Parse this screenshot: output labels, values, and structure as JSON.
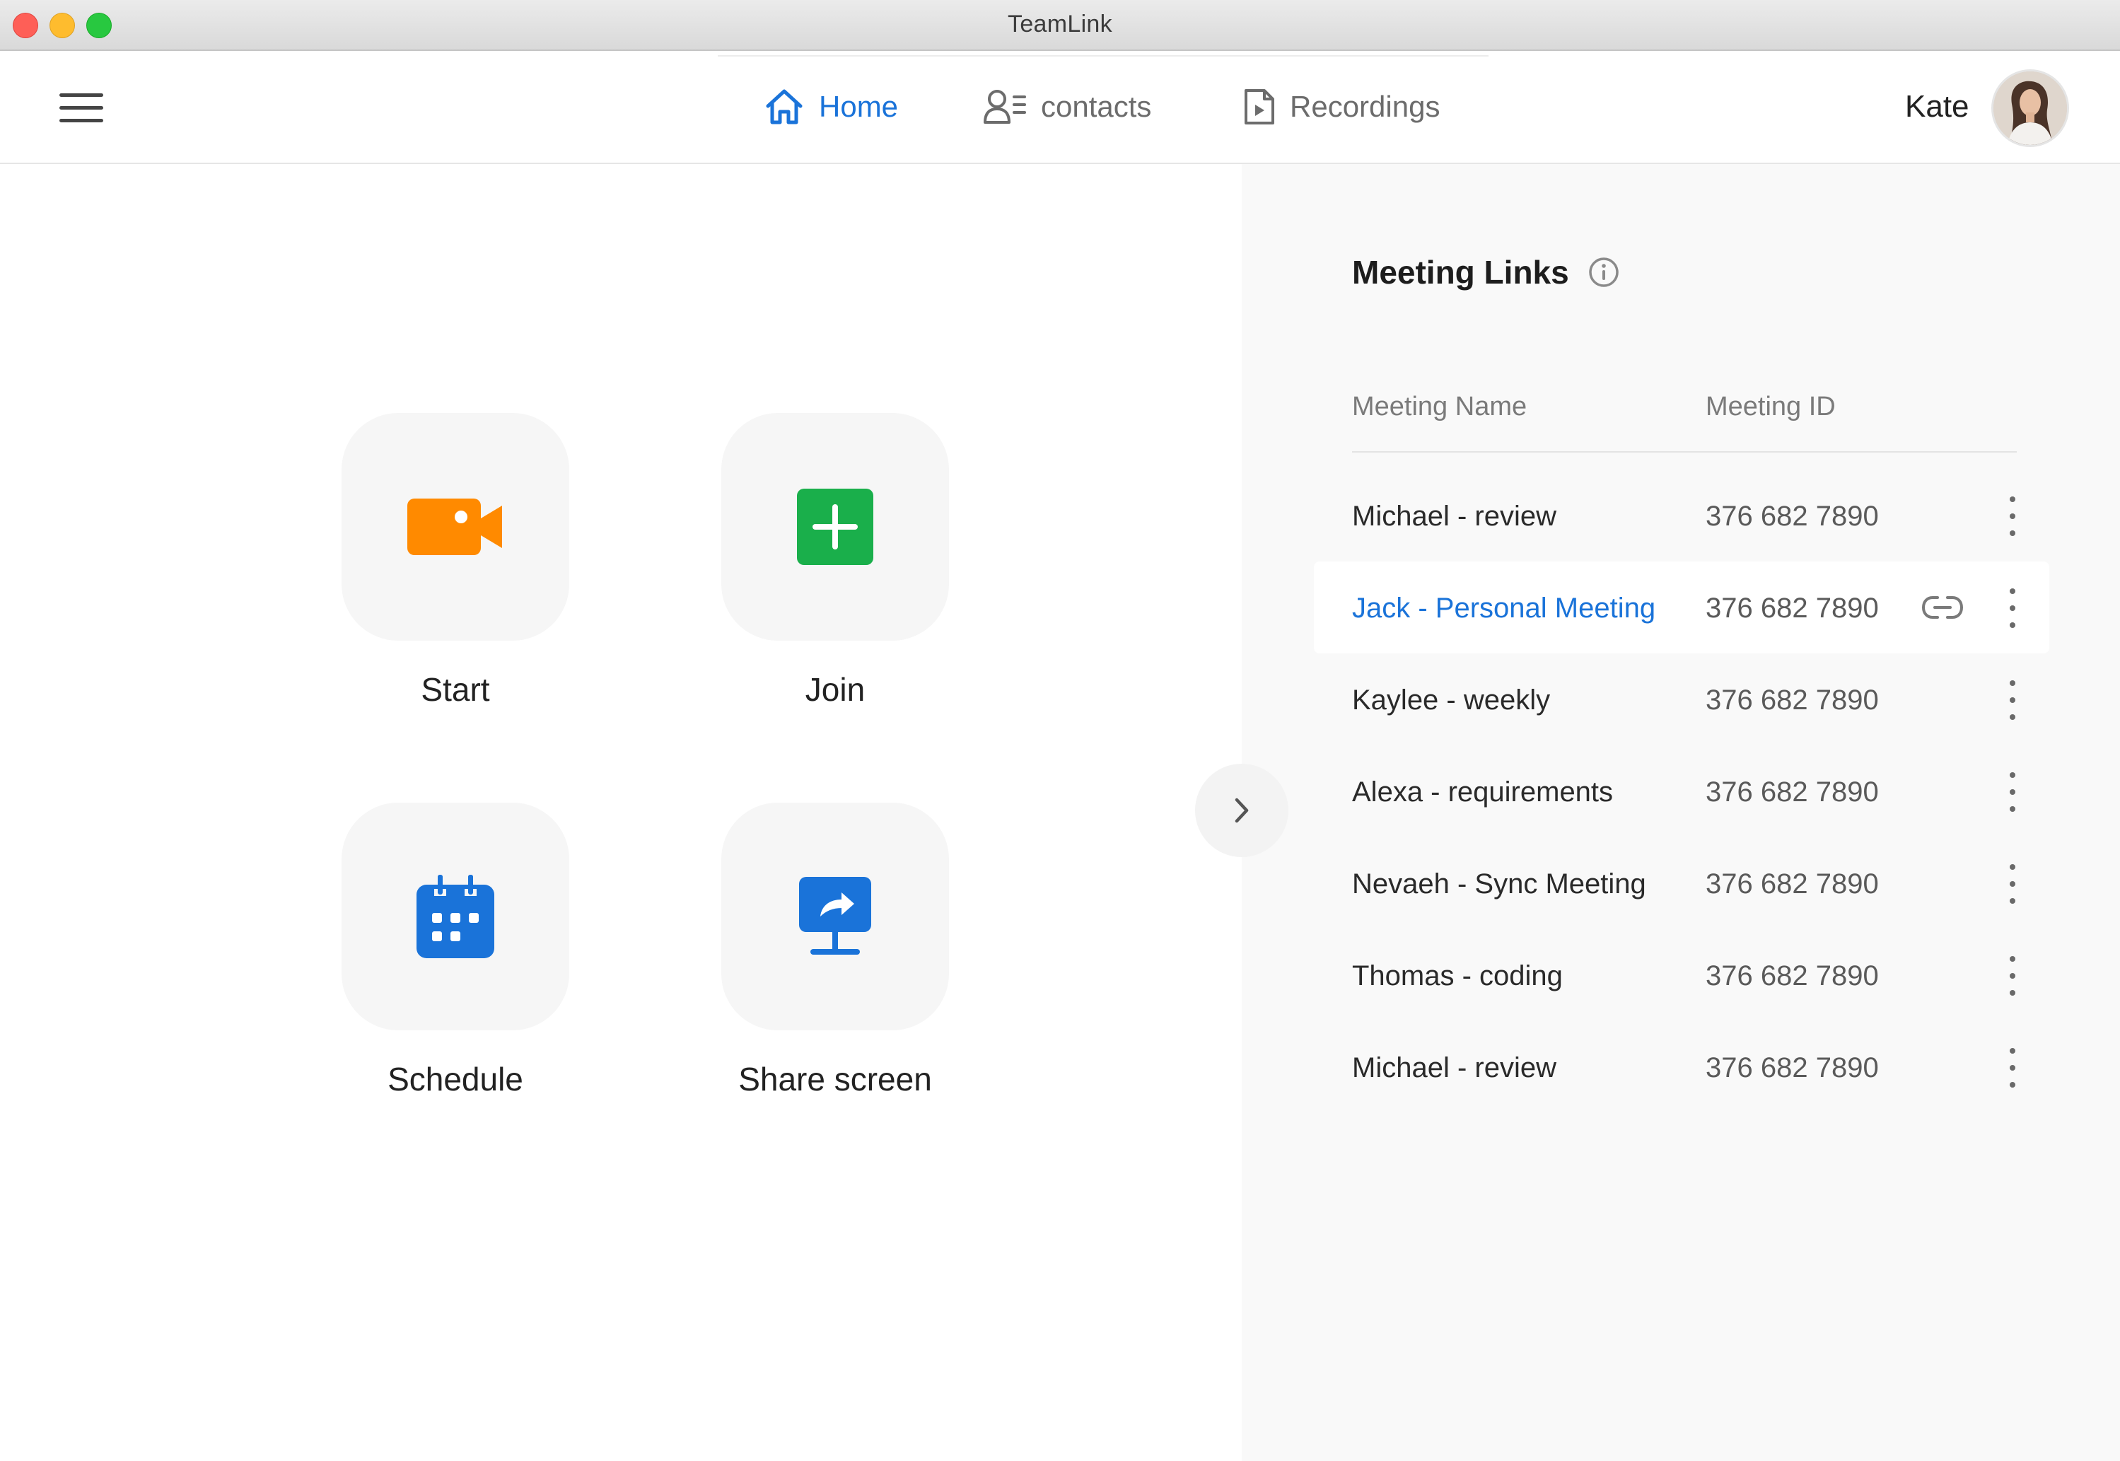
{
  "window": {
    "title": "TeamLink"
  },
  "nav": {
    "tabs": [
      {
        "label": "Home",
        "icon": "home-icon",
        "active": true
      },
      {
        "label": "contacts",
        "icon": "contacts-icon",
        "active": false
      },
      {
        "label": "Recordings",
        "icon": "recordings-icon",
        "active": false
      }
    ]
  },
  "user": {
    "name": "Kate"
  },
  "actions": [
    {
      "label": "Start",
      "icon": "video-camera-icon",
      "color": "#ff8a00"
    },
    {
      "label": "Join",
      "icon": "plus-icon",
      "color": "#1aaf4b"
    },
    {
      "label": "Schedule",
      "icon": "calendar-icon",
      "color": "#1a73d9"
    },
    {
      "label": "Share screen",
      "icon": "share-screen-icon",
      "color": "#1a73d9"
    }
  ],
  "meeting_links": {
    "title": "Meeting Links",
    "columns": [
      "Meeting Name",
      "Meeting ID"
    ],
    "rows": [
      {
        "name": "Michael - review",
        "id": "376 682 7890"
      },
      {
        "name": "Jack - Personal Meeting",
        "id": "376 682 7890",
        "selected": true
      },
      {
        "name": "Kaylee - weekly",
        "id": "376 682 7890"
      },
      {
        "name": "Alexa - requirements",
        "id": "376 682 7890"
      },
      {
        "name": "Nevaeh - Sync Meeting",
        "id": "376 682 7890"
      },
      {
        "name": "Thomas - coding",
        "id": "376 682 7890"
      },
      {
        "name": "Michael - review",
        "id": "376 682 7890"
      }
    ]
  },
  "colors": {
    "accent": "#1a73d9",
    "panel_bg": "#f9f9f9",
    "tile_bg": "#f6f6f6"
  }
}
